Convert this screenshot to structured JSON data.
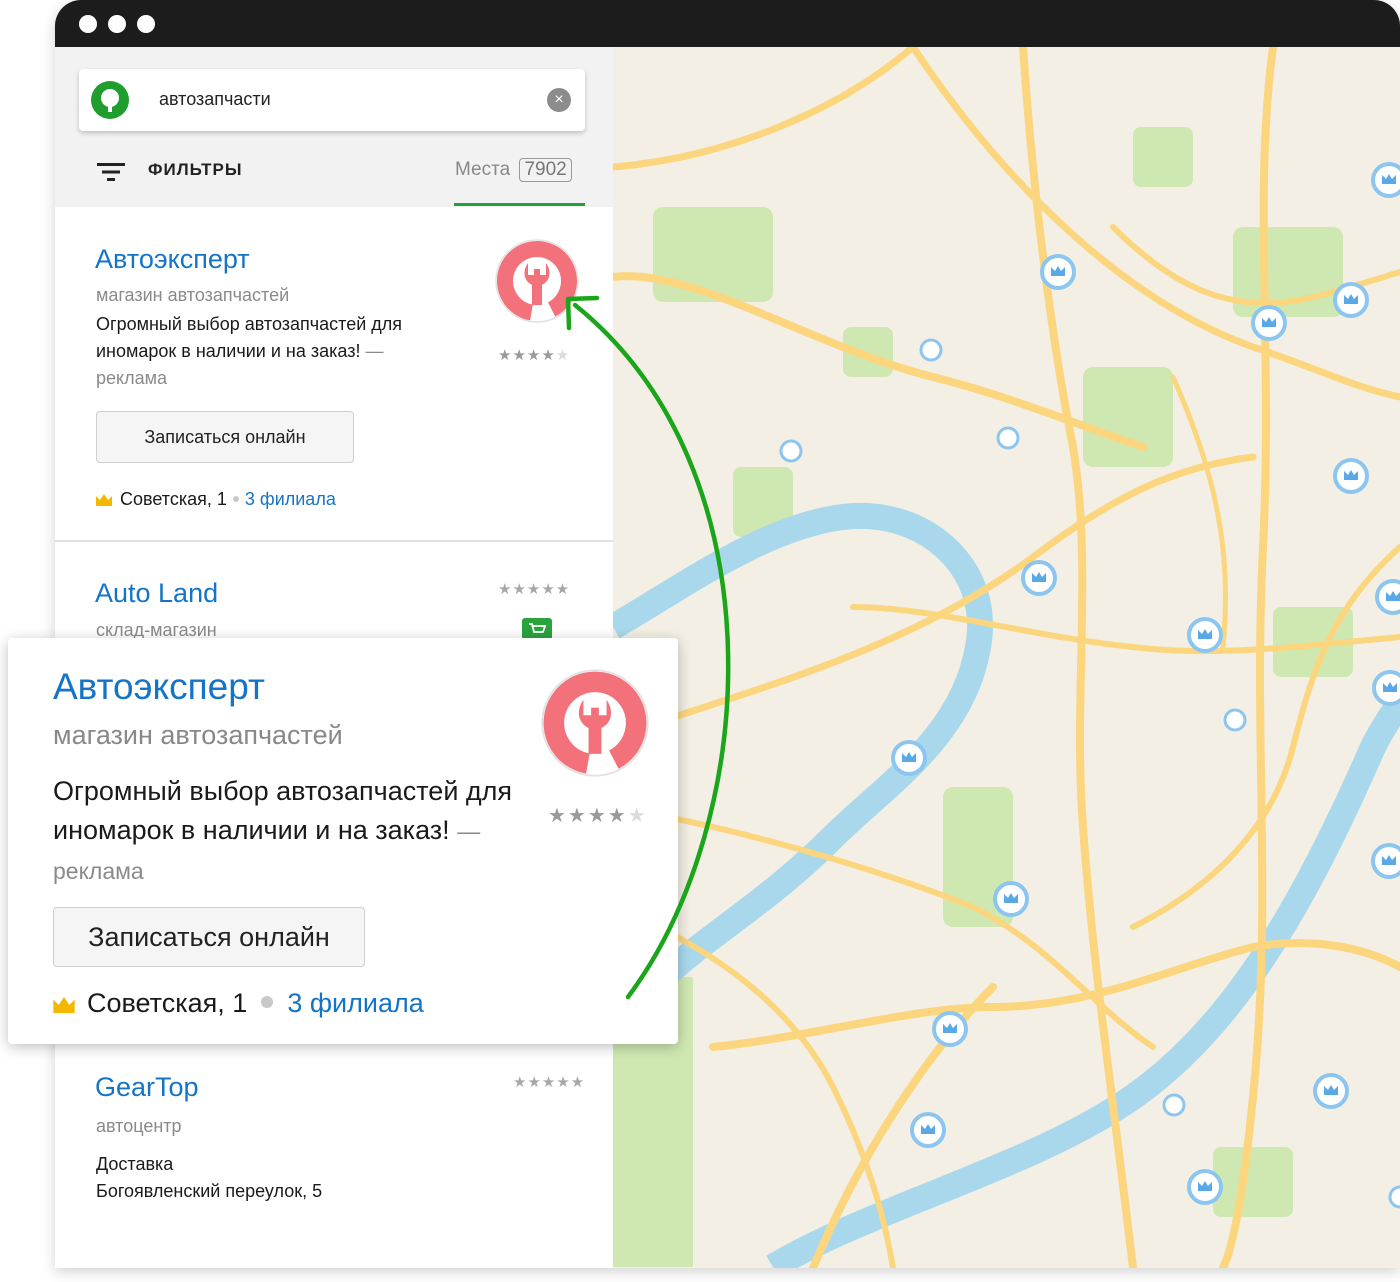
{
  "search": {
    "query": "автозапчасти"
  },
  "toolbar": {
    "filters_label": "ФИЛЬТРЫ",
    "places_label": "Места",
    "places_count": "7902"
  },
  "results": [
    {
      "title": "Автоэксперт",
      "category": "магазин автозапчастей",
      "description": "Огромный выбор автозапчастей для иномарок в наличии и на заказ!",
      "ad_label": "— реклама",
      "button_label": "Записаться онлайн",
      "address": "Советская, 1",
      "branches": "3 филиала",
      "rating": 4
    },
    {
      "title": "Auto Land",
      "category": "склад-магазин"
    },
    {
      "title": "GearTop",
      "category": "автоцентр",
      "delivery": "Доставка",
      "address": "Богоявленский переулок, 5"
    }
  ],
  "popup": {
    "title": "Автоэксперт",
    "category": "магазин автозапчастей",
    "description": "Огромный выбор автозапчастей для иномарок в наличии и на заказ!",
    "ad_label": "— реклама",
    "button_label": "Записаться онлайн",
    "address": "Советская, 1",
    "branches": "3 филиала",
    "rating": 4
  },
  "colors": {
    "link_blue": "#1474c8",
    "brand_green": "#1fa33a",
    "arrow_green": "#1aa51a",
    "logo_red": "#f2717a",
    "map_bg": "#f3efe4",
    "road": "#fbd67e",
    "river": "#a9d8ec",
    "park": "#cfe8b2",
    "pin_blue": "#8cc6f0"
  },
  "icons": [
    "search-logo-icon",
    "clear-icon",
    "filter-icon",
    "wrench-logo-icon",
    "crown-icon",
    "cart-icon",
    "map-pin-icon"
  ]
}
